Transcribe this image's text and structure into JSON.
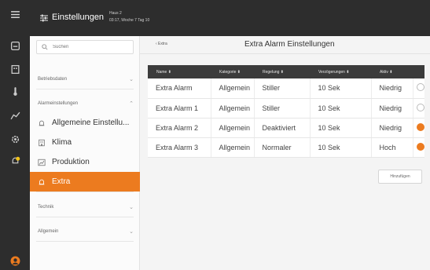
{
  "header": {
    "title": "Einstellungen",
    "sub_line1": "Haus 2",
    "sub_line2": "03:17, Woche 7 Tag 10"
  },
  "sidebar": {
    "search_placeholder": "Suchen",
    "group_betrieb": "Betriebsdaten",
    "group_alarm": "Alarmeinstellungen",
    "items": [
      {
        "label": "Allgemeine Einstellu...",
        "icon": "bell-icon"
      },
      {
        "label": "Klima",
        "icon": "building-icon"
      },
      {
        "label": "Produktion",
        "icon": "chart-icon"
      },
      {
        "label": "Extra",
        "icon": "bell-icon"
      }
    ],
    "group_technik": "Technik",
    "group_allgemein": "Allgemein"
  },
  "main": {
    "back_label": "‹ Extra",
    "title": "Extra Alarm Einstellungen",
    "columns": [
      "Name ⬍",
      "Kategorie ⬍",
      "Regelung ⬍",
      "Verzögerungen ⬍",
      "Aktiv ⬍",
      ""
    ],
    "rows": [
      {
        "name": "Extra Alarm",
        "kategorie": "Allgemein",
        "regelung": "Stiller",
        "delay": "10 Sek",
        "aktiv": "Niedrig",
        "active": false
      },
      {
        "name": "Extra Alarm 1",
        "kategorie": "Allgemein",
        "regelung": "Stiller",
        "delay": "10 Sek",
        "aktiv": "Niedrig",
        "active": false
      },
      {
        "name": "Extra Alarm 2",
        "kategorie": "Allgemein",
        "regelung": "Deaktiviert",
        "delay": "10 Sek",
        "aktiv": "Niedrig",
        "active": true
      },
      {
        "name": "Extra Alarm 3",
        "kategorie": "Allgemein",
        "regelung": "Normaler",
        "delay": "10 Sek",
        "aktiv": "Hoch",
        "active": true
      }
    ],
    "add_label": "Hinzufügen"
  },
  "colors": {
    "accent": "#ec7b1f",
    "dark": "#2d2d2d",
    "table_header": "#3b3b3b"
  }
}
